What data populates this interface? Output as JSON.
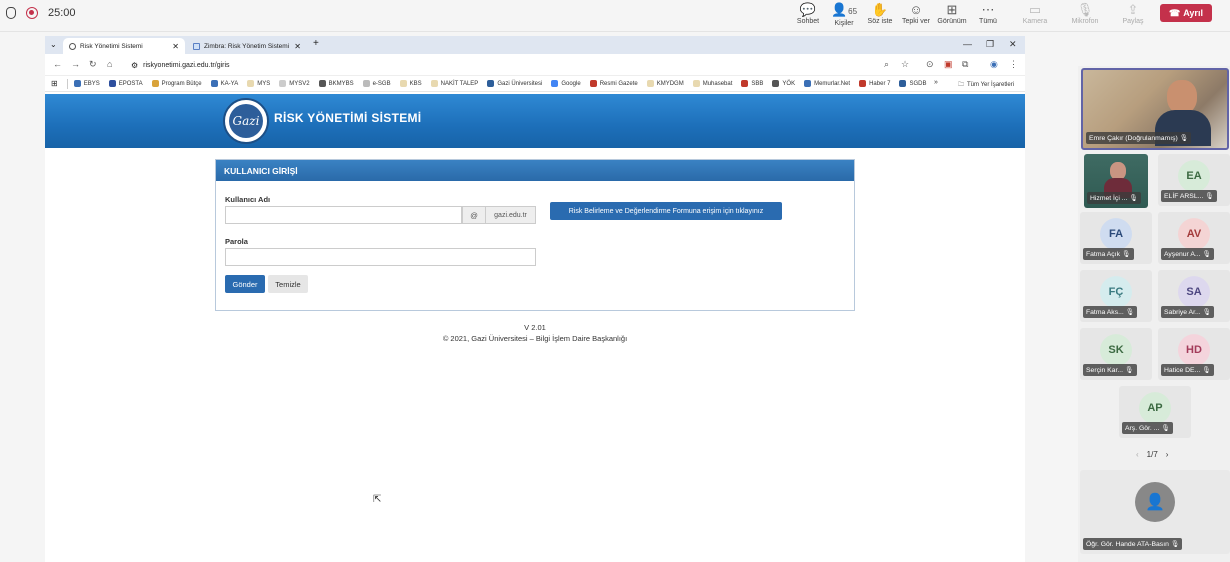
{
  "meeting": {
    "timer": "25:00",
    "buttons": [
      {
        "label": "Sohbet",
        "icon": "chat-icon",
        "glyph": "💬",
        "enabled": true
      },
      {
        "label": "Kişiler",
        "icon": "people-icon",
        "glyph": "👤",
        "count": "65",
        "enabled": true
      },
      {
        "label": "Söz iste",
        "icon": "raise-hand-icon",
        "glyph": "✋",
        "enabled": true
      },
      {
        "label": "Tepki ver",
        "icon": "emoji-icon",
        "glyph": "☺",
        "enabled": true
      },
      {
        "label": "Görünüm",
        "icon": "grid-icon",
        "glyph": "⊞",
        "enabled": true
      },
      {
        "label": "Tümü",
        "icon": "more-icon",
        "glyph": "⋯",
        "enabled": true
      },
      {
        "label": "Kamera",
        "icon": "camera-off-icon",
        "glyph": "▭",
        "enabled": false
      },
      {
        "label": "Mikrofon",
        "icon": "mic-off-icon",
        "glyph": "🎙",
        "enabled": false
      },
      {
        "label": "Paylaş",
        "icon": "share-icon",
        "glyph": "⇪",
        "enabled": false
      }
    ],
    "leave_label": "Ayrıl"
  },
  "browser": {
    "tabs": [
      {
        "title": "Risk Yönetimi Sistemi",
        "active": true
      },
      {
        "title": "Zimbra: Risk Yönetim Sistemi H",
        "active": false
      }
    ],
    "url": "riskyonetimi.gazi.edu.tr/giris",
    "bookmarks": [
      {
        "label": "EBYS",
        "color": "#3b6fb6"
      },
      {
        "label": "EPOSTA",
        "color": "#2d4f9e"
      },
      {
        "label": "Program Bütçe",
        "color": "#d9a33a"
      },
      {
        "label": "KA-YA",
        "color": "#3b6fb6"
      },
      {
        "label": "MYS",
        "color": "#e8d9b0"
      },
      {
        "label": "MYSV2",
        "color": "#cccccc"
      },
      {
        "label": "BKMYBS",
        "color": "#555555"
      },
      {
        "label": "e-SGB",
        "color": "#bbbbbb"
      },
      {
        "label": "KBS",
        "color": "#e8d9b0"
      },
      {
        "label": "NAKİT TALEP",
        "color": "#e8d9b0"
      },
      {
        "label": "Gazi Üniversitesi",
        "color": "#2d5e9a"
      },
      {
        "label": "Google",
        "color": "#4285f4"
      },
      {
        "label": "Resmi Gazete",
        "color": "#c0392b"
      },
      {
        "label": "KMYDGM",
        "color": "#e8d9b0"
      },
      {
        "label": "Muhasebat",
        "color": "#e8d9b0"
      },
      {
        "label": "SBB",
        "color": "#c0392b"
      },
      {
        "label": "YÖK",
        "color": "#555555"
      },
      {
        "label": "Memurlar.Net",
        "color": "#3b6fb6"
      },
      {
        "label": "Haber 7",
        "color": "#c0392b"
      },
      {
        "label": "SGDB",
        "color": "#2d5e9a"
      }
    ],
    "bookmarks_more": "»",
    "all_bookmarks": "Tüm Yer İşaretleri"
  },
  "site": {
    "title": "RİSK YÖNETİMİ SİSTEMİ",
    "logo_text": "Gazi",
    "panel_title": "KULLANICI GİRİŞİ",
    "username_label": "Kullanıcı Adı",
    "username_value": "",
    "at_sign": "@",
    "domain": "gazi.edu.tr",
    "risk_button": "Risk Belirleme ve Değerlendirme Formuna erişim için tıklayınız",
    "password_label": "Parola",
    "password_value": "",
    "submit_label": "Gönder",
    "clear_label": "Temizle",
    "version": "V 2.01",
    "copyright": "© 2021, Gazi Üniversitesi – Bilgi İşlem Daire Başkanlığı"
  },
  "participants": {
    "main": {
      "name": "Emre Çakır (Doğrulanmamış)"
    },
    "tiles": [
      {
        "name": "Hizmet İçi ...",
        "initials": "",
        "bg": "#2f5a52",
        "fg": "#ffffff",
        "video": true
      },
      {
        "name": "ELİF ARSL...",
        "initials": "EA",
        "bg": "#d7ebd9",
        "fg": "#3c6a42",
        "video": false
      },
      {
        "name": "Fatma Açık",
        "initials": "FA",
        "bg": "#cfdcf0",
        "fg": "#2b4a7a",
        "video": false
      },
      {
        "name": "Ayşenur A...",
        "initials": "AV",
        "bg": "#f4d4d4",
        "fg": "#a33b3b",
        "video": false
      },
      {
        "name": "Fatma Aks...",
        "initials": "FÇ",
        "bg": "#d5ecee",
        "fg": "#3a7a80",
        "video": false
      },
      {
        "name": "Sabriye Ar...",
        "initials": "SA",
        "bg": "#ddd8ee",
        "fg": "#4d4680",
        "video": false
      },
      {
        "name": "Serçin Kar...",
        "initials": "SK",
        "bg": "#d7ebd9",
        "fg": "#3c6a42",
        "video": false
      },
      {
        "name": "Hatice DE...",
        "initials": "HD",
        "bg": "#f4d4dc",
        "fg": "#a33b5a",
        "video": false
      },
      {
        "name": "Arş. Gör. ...",
        "initials": "AP",
        "bg": "#d7ebd9",
        "fg": "#3c6a42",
        "video": false
      }
    ],
    "pager": "1/7",
    "bottom": {
      "name": "Öğr. Gör. Hande ATA-Basın"
    }
  }
}
